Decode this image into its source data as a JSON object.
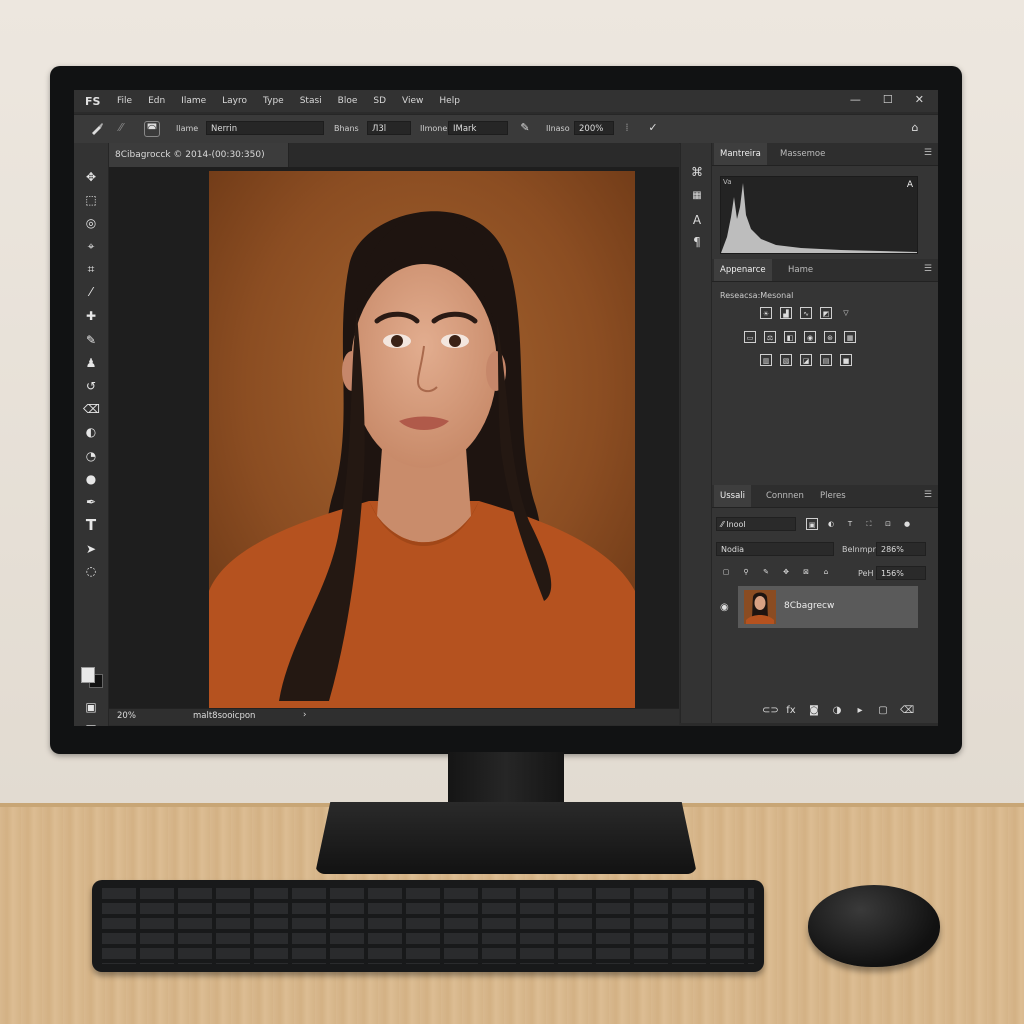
{
  "app": {
    "logo": "FS",
    "menu": [
      "File",
      "Edn",
      "Ilame",
      "Layro",
      "Type",
      "Stasi",
      "Bloe",
      "SD",
      "View",
      "Help"
    ],
    "window_controls": [
      "—",
      "☐",
      "✕"
    ]
  },
  "options_bar": {
    "name_label": "Ilame",
    "name_value": "Nerrin",
    "bhans_label": "Bhans",
    "bhans_value": "Л3l",
    "ilmone_label": "Ilmone",
    "ilmone_value": "IMark",
    "ilnaso_label": "Ilnaso",
    "zoom_value": "200%"
  },
  "document": {
    "tab_title": "8Cibagrocck © 2014-(00:30:350)",
    "status_zoom": "20%",
    "status_text": "malt8sooicpon",
    "status_arrow": "›"
  },
  "panels": {
    "histogram": {
      "tabs": [
        "Mantreira",
        "Massemoe"
      ],
      "label_left": "Va",
      "label_right": "A"
    },
    "appearance": {
      "tabs": [
        "Appenarce",
        "Hame"
      ],
      "subtitle": "Reseacsa:Mesonal"
    },
    "layers": {
      "tabs": [
        "Ussali",
        "Connnen",
        "Pleres"
      ],
      "kind_value": "⁄⁄ Inool",
      "blend_value": "Nodia",
      "opacity_label": "Belnmpr",
      "opacity_value": "286%",
      "fill_label": "PeH",
      "fill_value": "156%",
      "layer_name": "8Cbagrecw"
    }
  },
  "colors": {
    "ui_bg": "#353535",
    "backdrop": "#8a4c22",
    "shirt": "#b6521f",
    "hair": "#1f1410",
    "skin": "#d9a183"
  }
}
